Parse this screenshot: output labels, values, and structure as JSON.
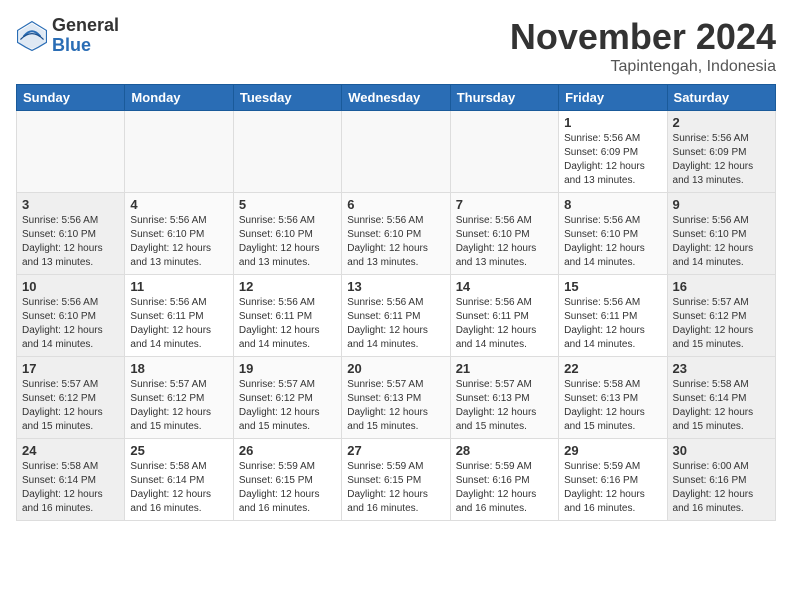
{
  "header": {
    "logo_general": "General",
    "logo_blue": "Blue",
    "month_title": "November 2024",
    "location": "Tapintengah, Indonesia"
  },
  "columns": [
    "Sunday",
    "Monday",
    "Tuesday",
    "Wednesday",
    "Thursday",
    "Friday",
    "Saturday"
  ],
  "weeks": [
    [
      {
        "day": "",
        "info": ""
      },
      {
        "day": "",
        "info": ""
      },
      {
        "day": "",
        "info": ""
      },
      {
        "day": "",
        "info": ""
      },
      {
        "day": "",
        "info": ""
      },
      {
        "day": "1",
        "info": "Sunrise: 5:56 AM\nSunset: 6:09 PM\nDaylight: 12 hours\nand 13 minutes."
      },
      {
        "day": "2",
        "info": "Sunrise: 5:56 AM\nSunset: 6:09 PM\nDaylight: 12 hours\nand 13 minutes."
      }
    ],
    [
      {
        "day": "3",
        "info": "Sunrise: 5:56 AM\nSunset: 6:10 PM\nDaylight: 12 hours\nand 13 minutes."
      },
      {
        "day": "4",
        "info": "Sunrise: 5:56 AM\nSunset: 6:10 PM\nDaylight: 12 hours\nand 13 minutes."
      },
      {
        "day": "5",
        "info": "Sunrise: 5:56 AM\nSunset: 6:10 PM\nDaylight: 12 hours\nand 13 minutes."
      },
      {
        "day": "6",
        "info": "Sunrise: 5:56 AM\nSunset: 6:10 PM\nDaylight: 12 hours\nand 13 minutes."
      },
      {
        "day": "7",
        "info": "Sunrise: 5:56 AM\nSunset: 6:10 PM\nDaylight: 12 hours\nand 13 minutes."
      },
      {
        "day": "8",
        "info": "Sunrise: 5:56 AM\nSunset: 6:10 PM\nDaylight: 12 hours\nand 14 minutes."
      },
      {
        "day": "9",
        "info": "Sunrise: 5:56 AM\nSunset: 6:10 PM\nDaylight: 12 hours\nand 14 minutes."
      }
    ],
    [
      {
        "day": "10",
        "info": "Sunrise: 5:56 AM\nSunset: 6:10 PM\nDaylight: 12 hours\nand 14 minutes."
      },
      {
        "day": "11",
        "info": "Sunrise: 5:56 AM\nSunset: 6:11 PM\nDaylight: 12 hours\nand 14 minutes."
      },
      {
        "day": "12",
        "info": "Sunrise: 5:56 AM\nSunset: 6:11 PM\nDaylight: 12 hours\nand 14 minutes."
      },
      {
        "day": "13",
        "info": "Sunrise: 5:56 AM\nSunset: 6:11 PM\nDaylight: 12 hours\nand 14 minutes."
      },
      {
        "day": "14",
        "info": "Sunrise: 5:56 AM\nSunset: 6:11 PM\nDaylight: 12 hours\nand 14 minutes."
      },
      {
        "day": "15",
        "info": "Sunrise: 5:56 AM\nSunset: 6:11 PM\nDaylight: 12 hours\nand 14 minutes."
      },
      {
        "day": "16",
        "info": "Sunrise: 5:57 AM\nSunset: 6:12 PM\nDaylight: 12 hours\nand 15 minutes."
      }
    ],
    [
      {
        "day": "17",
        "info": "Sunrise: 5:57 AM\nSunset: 6:12 PM\nDaylight: 12 hours\nand 15 minutes."
      },
      {
        "day": "18",
        "info": "Sunrise: 5:57 AM\nSunset: 6:12 PM\nDaylight: 12 hours\nand 15 minutes."
      },
      {
        "day": "19",
        "info": "Sunrise: 5:57 AM\nSunset: 6:12 PM\nDaylight: 12 hours\nand 15 minutes."
      },
      {
        "day": "20",
        "info": "Sunrise: 5:57 AM\nSunset: 6:13 PM\nDaylight: 12 hours\nand 15 minutes."
      },
      {
        "day": "21",
        "info": "Sunrise: 5:57 AM\nSunset: 6:13 PM\nDaylight: 12 hours\nand 15 minutes."
      },
      {
        "day": "22",
        "info": "Sunrise: 5:58 AM\nSunset: 6:13 PM\nDaylight: 12 hours\nand 15 minutes."
      },
      {
        "day": "23",
        "info": "Sunrise: 5:58 AM\nSunset: 6:14 PM\nDaylight: 12 hours\nand 15 minutes."
      }
    ],
    [
      {
        "day": "24",
        "info": "Sunrise: 5:58 AM\nSunset: 6:14 PM\nDaylight: 12 hours\nand 16 minutes."
      },
      {
        "day": "25",
        "info": "Sunrise: 5:58 AM\nSunset: 6:14 PM\nDaylight: 12 hours\nand 16 minutes."
      },
      {
        "day": "26",
        "info": "Sunrise: 5:59 AM\nSunset: 6:15 PM\nDaylight: 12 hours\nand 16 minutes."
      },
      {
        "day": "27",
        "info": "Sunrise: 5:59 AM\nSunset: 6:15 PM\nDaylight: 12 hours\nand 16 minutes."
      },
      {
        "day": "28",
        "info": "Sunrise: 5:59 AM\nSunset: 6:16 PM\nDaylight: 12 hours\nand 16 minutes."
      },
      {
        "day": "29",
        "info": "Sunrise: 5:59 AM\nSunset: 6:16 PM\nDaylight: 12 hours\nand 16 minutes."
      },
      {
        "day": "30",
        "info": "Sunrise: 6:00 AM\nSunset: 6:16 PM\nDaylight: 12 hours\nand 16 minutes."
      }
    ]
  ]
}
